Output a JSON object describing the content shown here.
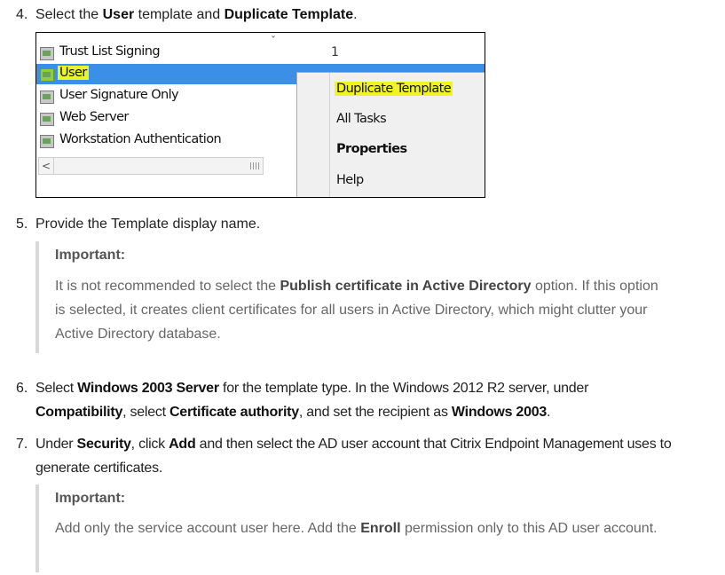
{
  "step4": {
    "num": "4.",
    "t1": "Select the ",
    "b1": "User",
    "t2": " template and ",
    "b2": "Duplicate Template",
    "t3": "."
  },
  "screenshot": {
    "rows": [
      "Trust List Signing",
      "User",
      "User Signature Only",
      "Web Server",
      "Workstation Authentication"
    ],
    "count_value": "1",
    "menu": {
      "duplicate": "Duplicate Template",
      "all_tasks": "All Tasks",
      "properties": "Properties",
      "help": "Help"
    },
    "highlight_color": "#f0f521",
    "selection_color": "#3b8fe6"
  },
  "step5": {
    "num": "5.",
    "text": "Provide the Template display name."
  },
  "note1": {
    "title": "Important:",
    "t1": "It is not recommended to select the ",
    "b1": "Publish certificate in Active Directory",
    "t2": " option. If this option is selected, it creates client certificates for all users in Active Directory, which might clutter your Active Directory database."
  },
  "step6": {
    "num": "6.",
    "t1": "Select ",
    "b1": "Windows 2003 Server",
    "t2": " for the template type. In the Windows 2012 R2 server, under ",
    "b2": "Compatibility",
    "t3": ", select ",
    "b3": "Certificate authority",
    "t4": ", and set the recipient as ",
    "b4": "Windows 2003",
    "t5": "."
  },
  "step7": {
    "num": "7.",
    "t1": "Under ",
    "b1": "Security",
    "t2": ", click ",
    "b2": "Add",
    "t3": " and then select the AD user account that Citrix Endpoint Management uses to generate certificates."
  },
  "note2": {
    "title": "Important:",
    "t1": "Add only the service account user here. Add the ",
    "b1": "Enroll",
    "t2": " permission only to this AD user account."
  }
}
